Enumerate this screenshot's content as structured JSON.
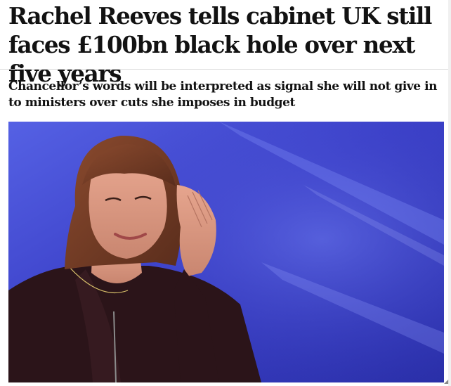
{
  "article": {
    "headline": "Rachel Reeves tells cabinet UK still faces £100bn black hole over next five years",
    "standfirst": "Chancellor’s words will be interpreted as signal she will not give in to ministers over cuts she imposes in budget"
  },
  "image": {
    "subject": "woman-portrait-photo"
  },
  "colors": {
    "background": "#ffffff",
    "text": "#121212",
    "photo_backdrop": "#3a3fc6"
  }
}
